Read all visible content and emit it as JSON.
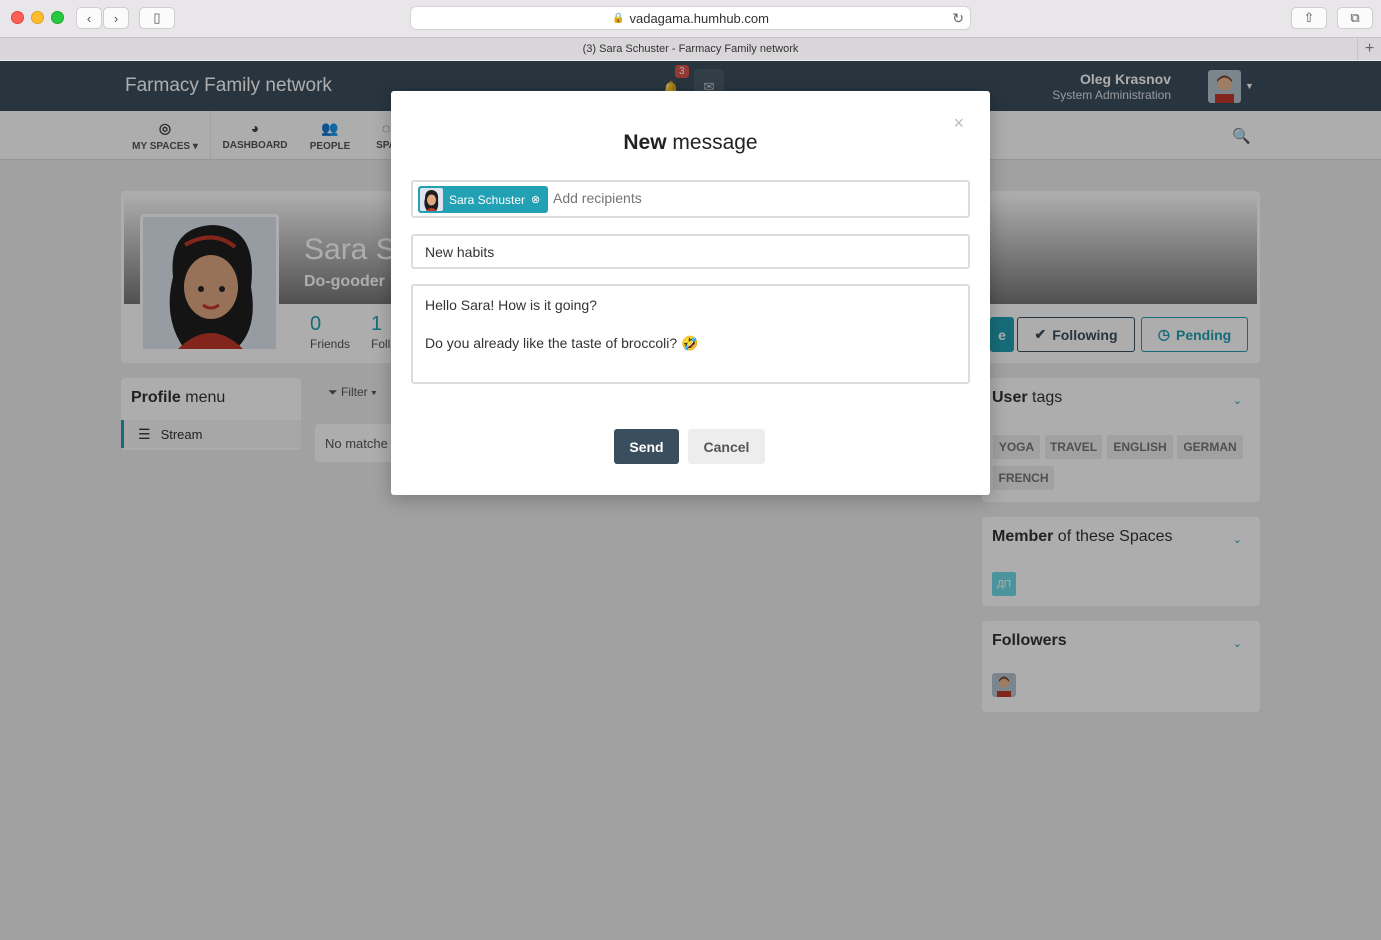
{
  "browser": {
    "url": "vadagama.humhub.com",
    "tab_title": "(3) Sara Schuster - Farmacy Family network",
    "icons": [
      "back-icon",
      "forward-icon",
      "sidebar-icon",
      "lock-icon",
      "reload-icon",
      "share-icon",
      "tabs-icon",
      "plus-icon"
    ]
  },
  "header": {
    "brand": "Farmacy Family network",
    "notification_count": "3",
    "user_name": "Oleg Krasnov",
    "user_role": "System Administration"
  },
  "nav": {
    "items": [
      {
        "label": "MY SPACES ▾",
        "icon": "target-icon"
      },
      {
        "label": "DASHBOARD",
        "icon": "dashboard-icon"
      },
      {
        "label": "PEOPLE",
        "icon": "people-icon"
      },
      {
        "label": "SPA",
        "icon": "spaces-icon"
      }
    ]
  },
  "profile": {
    "name": "Sara Sc",
    "title": "Do-gooder",
    "stats": [
      {
        "value": "0",
        "label": "Friends"
      },
      {
        "value": "1",
        "label": "Foll"
      }
    ],
    "buttons": {
      "friend": "e",
      "following": "Following",
      "pending": "Pending"
    }
  },
  "profile_menu": {
    "title_bold": "Profile",
    "title_rest": " menu",
    "items": [
      "Stream"
    ]
  },
  "stream": {
    "filter_label": "Filter ▾",
    "empty_text": "No matche"
  },
  "sidebar": {
    "user_tags": {
      "title_bold": "User",
      "title_rest": " tags",
      "tags": [
        "YOGA",
        "TRAVEL",
        "ENGLISH",
        "GERMAN",
        "FRENCH"
      ]
    },
    "spaces": {
      "title_bold": "Member",
      "title_rest": " of these Spaces",
      "badge": "ДП"
    },
    "followers": {
      "title_bold": "Followers"
    }
  },
  "modal": {
    "title_bold": "New",
    "title_rest": " message",
    "close": "×",
    "recipient_chip": "Sara Schuster",
    "recipient_placeholder": "Add recipients",
    "subject_value": "New habits",
    "body_line1": "Hello Sara! How is it going?",
    "body_line2": "Do you already like the taste of broccoli? 🤣",
    "send_label": "Send",
    "cancel_label": "Cancel"
  },
  "colors": {
    "accent": "#21a1b3",
    "primary": "#3b4e5e",
    "background": "#ededed"
  }
}
